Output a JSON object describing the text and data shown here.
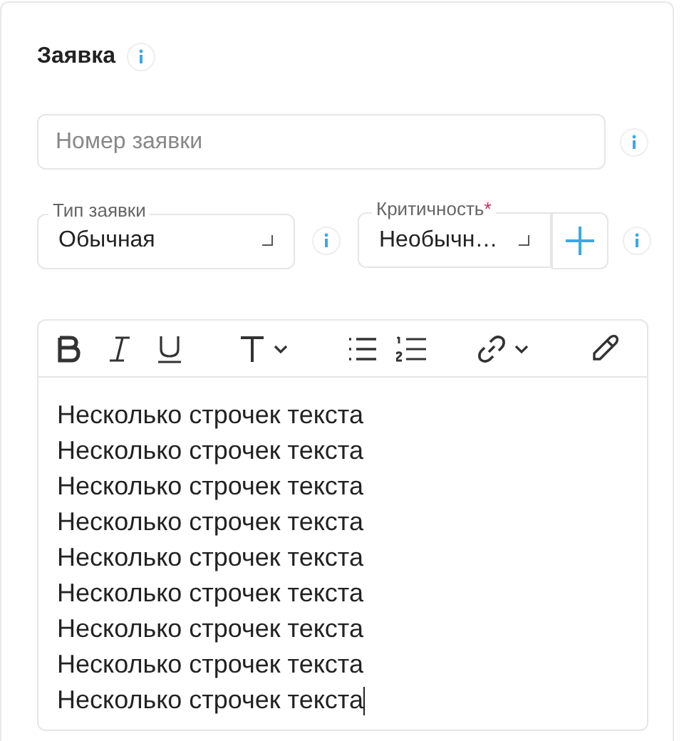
{
  "title": "Заявка",
  "number_field": {
    "placeholder": "Номер заявки"
  },
  "type_field": {
    "label": "Тип заявки",
    "value": "Обычная"
  },
  "criticality_field": {
    "label": "Критичность",
    "required_mark": "*",
    "value": "Необычн…"
  },
  "editor": {
    "lines": [
      "Несколько строчек текста",
      "Несколько строчек текста",
      "Несколько строчек текста",
      "Несколько строчек текста",
      "Несколько строчек текста",
      "Несколько строчек текста",
      "Несколько строчек текста",
      "Несколько строчек текста",
      "Несколько строчек текста"
    ]
  }
}
